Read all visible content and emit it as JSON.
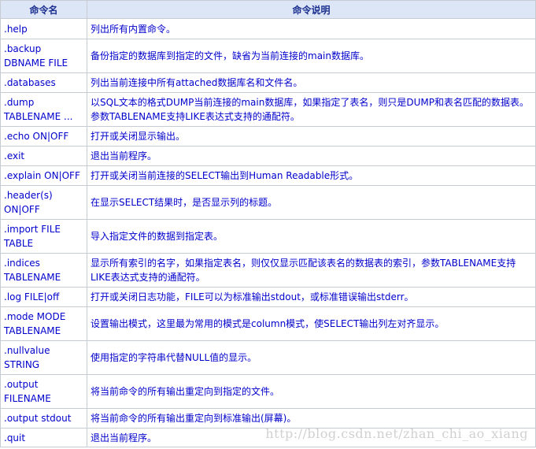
{
  "table": {
    "headers": [
      "命令名",
      "命令说明"
    ],
    "rows": [
      {
        "cmd": ".help",
        "desc": "列出所有内置命令。"
      },
      {
        "cmd": ".backup\nDBNAME FILE",
        "desc": "备份指定的数据库到指定的文件，缺省为当前连接的main数据库。"
      },
      {
        "cmd": ".databases",
        "desc": "列出当前连接中所有attached数据库名和文件名。"
      },
      {
        "cmd": ".dump\nTABLENAME ...",
        "desc": "以SQL文本的格式DUMP当前连接的main数据库，如果指定了表名，则只是DUMP和表名匹配的数据表。\n参数TABLENAME支持LIKE表达式支持的通配符。"
      },
      {
        "cmd": ".echo ON|OFF",
        "desc": "打开或关闭显示输出。"
      },
      {
        "cmd": ".exit",
        "desc": "退出当前程序。"
      },
      {
        "cmd": ".explain ON|OFF",
        "desc": "打开或关闭当前连接的SELECT输出到Human Readable形式。"
      },
      {
        "cmd": ".header(s)\nON|OFF",
        "desc": "在显示SELECT结果时，是否显示列的标题。"
      },
      {
        "cmd": ".import FILE\nTABLE",
        "desc": "导入指定文件的数据到指定表。"
      },
      {
        "cmd": ".indices\nTABLENAME",
        "desc": "显示所有索引的名字，如果指定表名，则仅仅显示匹配该表名的数据表的索引，参数TABLENAME支持\nLIKE表达式支持的通配符。"
      },
      {
        "cmd": ".log FILE|off",
        "desc": "打开或关闭日志功能，FILE可以为标准输出stdout，或标准错误输出stderr。"
      },
      {
        "cmd": ".mode MODE\nTABLENAME",
        "desc": "设置输出模式，这里最为常用的模式是column模式，使SELECT输出列左对齐显示。"
      },
      {
        "cmd": ".nullvalue\nSTRING",
        "desc": "使用指定的字符串代替NULL值的显示。"
      },
      {
        "cmd": ".output\nFILENAME",
        "desc": "将当前命令的所有输出重定向到指定的文件。"
      },
      {
        "cmd": ".output stdout",
        "desc": "将当前命令的所有输出重定向到标准输出(屏幕)。"
      },
      {
        "cmd": ".quit",
        "desc": "退出当前程序。"
      }
    ]
  },
  "watermark": "http://blog.csdn.net/zhan_chi_ao_xiang"
}
